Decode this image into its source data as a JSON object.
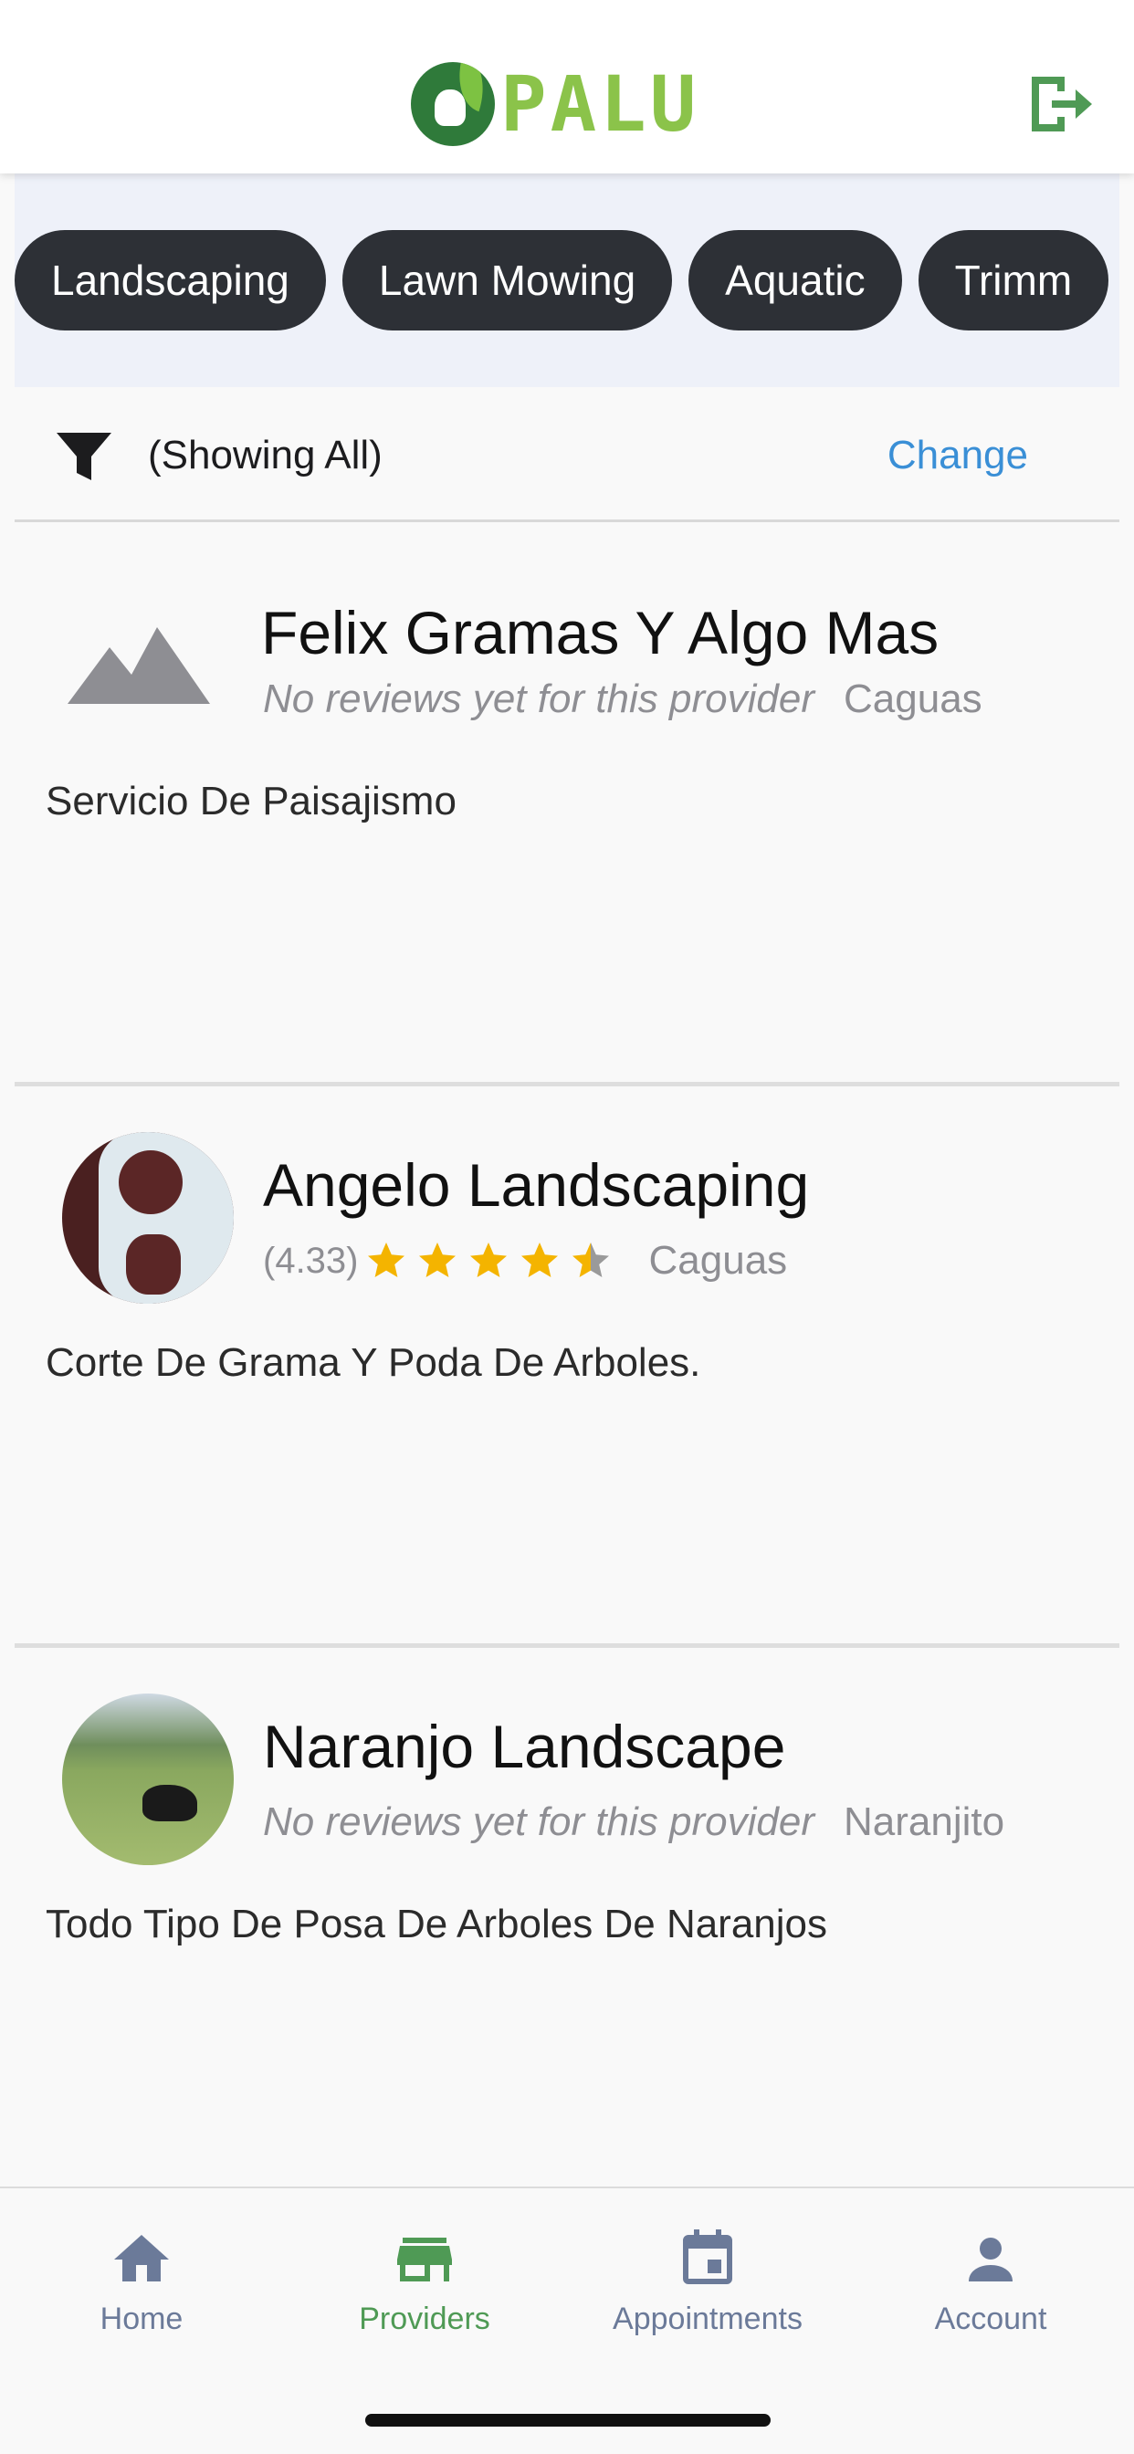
{
  "app": {
    "logo_text": "PALU",
    "logout_icon": "logout-icon"
  },
  "categories": [
    "Landscaping",
    "Lawn Mowing",
    "Aquatic",
    "Trimm"
  ],
  "filter": {
    "status": "(Showing All)",
    "change_label": "Change"
  },
  "providers": [
    {
      "name": "Felix Gramas Y Algo Mas",
      "reviews_text": "No reviews yet for this provider",
      "city": "Caguas",
      "description": "Servicio De Paisajismo",
      "image": "placeholder-image-icon"
    },
    {
      "name": "Angelo Landscaping",
      "rating_text": "(4.33)",
      "rating": 4.33,
      "city": "Caguas",
      "description": "Corte De Grama Y Poda De Arboles.",
      "image": "provider-photo"
    },
    {
      "name": "Naranjo Landscape",
      "reviews_text": "No reviews yet for this provider",
      "city": "Naranjito",
      "description": "Todo Tipo De Posa De Arboles De Naranjos",
      "image": "provider-photo"
    }
  ],
  "nav": [
    {
      "label": "Home",
      "icon": "home-icon",
      "active": false
    },
    {
      "label": "Providers",
      "icon": "store-icon",
      "active": true
    },
    {
      "label": "Appointments",
      "icon": "calendar-icon",
      "active": false
    },
    {
      "label": "Account",
      "icon": "person-icon",
      "active": false
    }
  ],
  "colors": {
    "brand_green": "#8bc34a",
    "chip_bg": "#2d3036",
    "link_blue": "#3a8fd6",
    "star_gold": "#f4b400",
    "nav_active": "#4f9a55",
    "nav_inactive": "#6b7a99"
  }
}
